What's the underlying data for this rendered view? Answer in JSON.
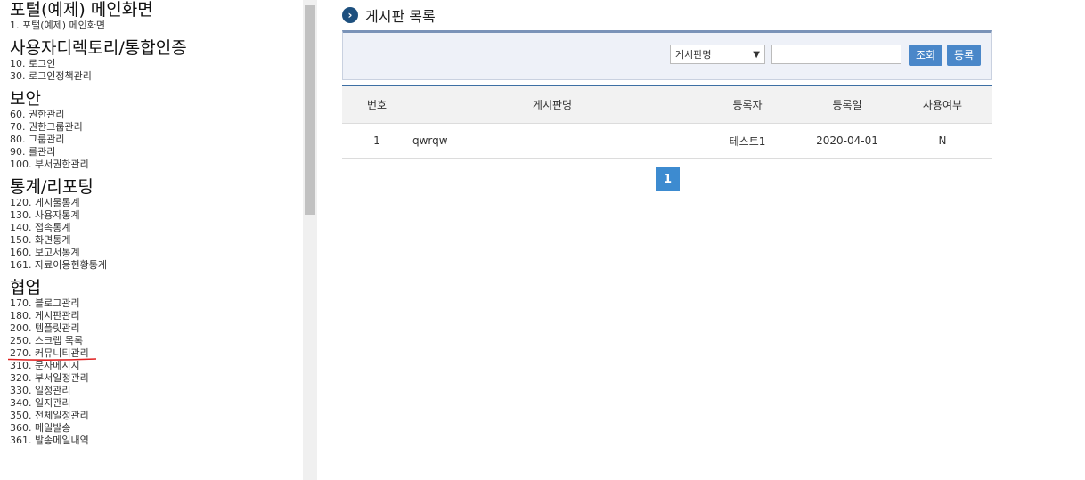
{
  "sidebar": {
    "sections": [
      {
        "title": "포털(예제) 메인화면",
        "items": [
          "1. 포털(예제) 메인화면"
        ]
      },
      {
        "title": "사용자디렉토리/통합인증",
        "items": [
          "10. 로그인",
          "30. 로그인정책관리"
        ]
      },
      {
        "title": "보안",
        "items": [
          "60. 권한관리",
          "70. 권한그룹관리",
          "80. 그룹관리",
          "90. 롤관리",
          "100. 부서권한관리"
        ]
      },
      {
        "title": "통계/리포팅",
        "items": [
          "120. 게시물통계",
          "130. 사용자통계",
          "140. 접속통계",
          "150. 화면통계",
          "160. 보고서통계",
          "161. 자료이용현황통계"
        ]
      },
      {
        "title": "협업",
        "items": [
          "170. 블로그관리",
          "180. 게시판관리",
          "200. 템플릿관리",
          "250. 스크랩 목록",
          "270. 커뮤니티관리",
          "310. 문자메시지",
          "320. 부서일정관리",
          "330. 일정관리",
          "340. 일지관리",
          "350. 전체일정관리",
          "360. 메일발송",
          "361. 발송메일내역"
        ]
      }
    ],
    "highlight_color": "#e02020"
  },
  "main": {
    "title": "게시판 목록",
    "search": {
      "select_value": "게시판명",
      "input_value": "",
      "search_label": "조회",
      "register_label": "등록"
    },
    "table": {
      "headers": {
        "num": "번호",
        "name": "게시판명",
        "writer": "등록자",
        "date": "등록일",
        "use": "사용여부"
      },
      "rows": [
        {
          "num": "1",
          "name": "qwrqw",
          "writer": "테스트1",
          "date": "2020-04-01",
          "use": "N"
        }
      ]
    },
    "pager": {
      "current": "1"
    }
  },
  "colors": {
    "accent": "#3d8bd0",
    "button": "#4a87c9",
    "title_icon": "#1d4f7e"
  }
}
